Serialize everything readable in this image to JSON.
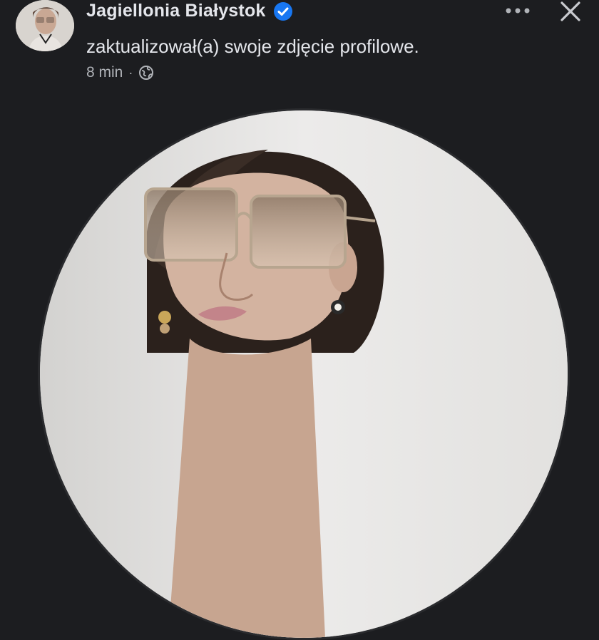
{
  "post": {
    "author_name": "Jagiellonia Białystok",
    "action_text": "zaktualizował(a) swoje zdjęcie profilowe.",
    "time": "8 min",
    "separator": "·",
    "audience_icon": "globe-icon",
    "verified_icon": "verified-badge-icon"
  },
  "header_actions": {
    "more_icon": "more-options-icon",
    "close_icon": "close-icon"
  },
  "colors": {
    "background": "#1c1d20",
    "text_primary": "#e4e6eb",
    "text_secondary": "#b0b3b8",
    "verified_blue": "#1877f2"
  }
}
